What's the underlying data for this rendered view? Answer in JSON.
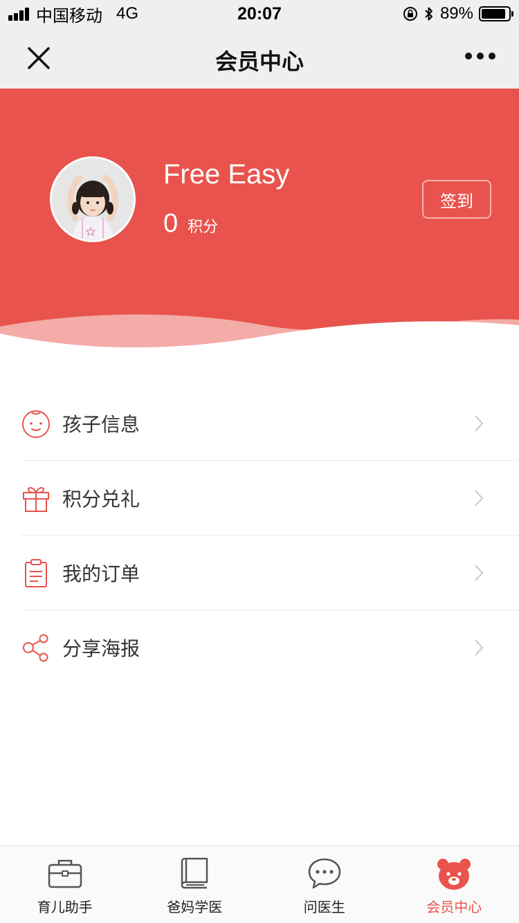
{
  "status_bar": {
    "carrier": "中国移动",
    "network": "4G",
    "time": "20:07",
    "battery": "89%",
    "battery_level": 0.89
  },
  "nav": {
    "title": "会员中心",
    "close_icon": "close-icon",
    "more_icon": "more-icon"
  },
  "profile": {
    "name": "Free Easy",
    "points_value": "0",
    "points_unit": "积分",
    "checkin_label": "签到"
  },
  "menu": {
    "items": [
      {
        "label": "孩子信息",
        "icon": "baby-face-icon"
      },
      {
        "label": "积分兑礼",
        "icon": "gift-icon"
      },
      {
        "label": "我的订单",
        "icon": "clipboard-icon"
      },
      {
        "label": "分享海报",
        "icon": "share-icon"
      }
    ]
  },
  "tabs": {
    "items": [
      {
        "label": "育儿助手",
        "icon": "briefcase-icon"
      },
      {
        "label": "爸妈学医",
        "icon": "book-icon"
      },
      {
        "label": "问医生",
        "icon": "chat-icon"
      },
      {
        "label": "会员中心",
        "icon": "bear-icon"
      }
    ],
    "active": "会员中心"
  },
  "colors": {
    "accent": "#e9534d",
    "text": "#333333",
    "inactive_icon": "#555555"
  }
}
